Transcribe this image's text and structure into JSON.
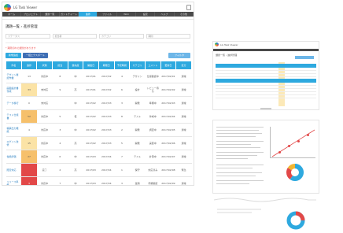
{
  "app": {
    "brand": "LG Task Viewer"
  },
  "nav": {
    "items": [
      "ホーム",
      "プロジェクト",
      "課題一覧",
      "ガントチャート",
      "進捗",
      "ファイル",
      "Wiki",
      "設定",
      "ヘルプ",
      "その他"
    ],
    "active_index": 4
  },
  "page": {
    "title": "課題一覧 › 進捗管理"
  },
  "filters": [
    "ステータス",
    "担当者",
    "カテゴリ",
    "期間"
  ],
  "note": "* 期限切れの課題があります",
  "buttons": {
    "add": "新規追加",
    "export": "一括エクスポート",
    "right": "フィルタ"
  },
  "table": {
    "headers": [
      "件名",
      "進捗",
      "状態",
      "担当",
      "優先度",
      "開始日",
      "期限日",
      "予定時間",
      "カテゴリ",
      "コメント",
      "更新日",
      "区分"
    ],
    "rows": [
      {
        "title": "デザイン確認作業",
        "progress": "13",
        "status": "対応中",
        "owner": "8",
        "priority": "中",
        "start": "2017/01",
        "due": "2017/02",
        "hours": "4",
        "cat": "デザイン",
        "comment": "仕様確認中",
        "updated": "2017/02/01",
        "kind": "通常"
      },
      {
        "title": "画面設計書作成",
        "progress": "33",
        "status": "未対応",
        "owner": "9",
        "priority": "高",
        "start": "2017/01",
        "due": "2017/02",
        "hours": "6",
        "cat": "設計",
        "comment": "レビュー待ち",
        "updated": "2017/02/02",
        "kind": "通常"
      },
      {
        "title": "データ移行",
        "progress": "0",
        "status": "未対応",
        "owner": "",
        "priority": "中",
        "start": "2017/02",
        "due": "2017/03",
        "hours": "3",
        "cat": "開発",
        "comment": "準備中",
        "updated": "2017/02/03",
        "kind": "通常"
      },
      {
        "title": "テスト仕様書",
        "progress": "52",
        "status": "対応中",
        "owner": "5",
        "priority": "低",
        "start": "2017/02",
        "due": "2017/03",
        "hours": "8",
        "cat": "テスト",
        "comment": "作成中",
        "updated": "2017/02/04",
        "kind": "通常"
      },
      {
        "title": "帳票出力機能",
        "progress": "4",
        "status": "対応中",
        "owner": "3",
        "priority": "中",
        "start": "2017/02",
        "due": "2017/03",
        "hours": "2",
        "cat": "開発",
        "comment": "調査中",
        "updated": "2017/02/05",
        "kind": "通常"
      },
      {
        "title": "ログイン改修",
        "progress": "15",
        "status": "対応中",
        "owner": "4",
        "priority": "高",
        "start": "2017/02",
        "due": "2017/03",
        "hours": "5",
        "cat": "開発",
        "comment": "実装中",
        "updated": "2017/02/06",
        "kind": "通常"
      },
      {
        "title": "性能評価",
        "progress": "27",
        "status": "対応中",
        "owner": "6",
        "priority": "中",
        "start": "2017/03",
        "due": "2017/04",
        "hours": "7",
        "cat": "テスト",
        "comment": "計測中",
        "updated": "2017/02/07",
        "kind": "通常"
      },
      {
        "title": "障害対応",
        "progress": "",
        "status": "完了",
        "owner": "2",
        "priority": "高",
        "start": "2017/03",
        "due": "2017/04",
        "hours": "1",
        "cat": "保守",
        "comment": "対応済み",
        "updated": "2017/02/08",
        "kind": "緊急"
      },
      {
        "title": "リリース準備",
        "progress": "3",
        "status": "対応中",
        "owner": "7",
        "priority": "中",
        "start": "2017/03",
        "due": "2017/04",
        "hours": "3",
        "cat": "運用",
        "comment": "手順確認",
        "updated": "2017/02/09",
        "kind": "通常"
      }
    ],
    "progress_colors": [
      "",
      "c-yellow",
      "",
      "c-orange",
      "",
      "c-yellow",
      "c-orange",
      "c-red",
      "c-red"
    ]
  },
  "colors": {
    "accent": "#2ea9df",
    "nav_bg": "#4a4a4a",
    "warn": "#e24848",
    "yellow": "#fbe3a6",
    "orange": "#f6c06b"
  }
}
